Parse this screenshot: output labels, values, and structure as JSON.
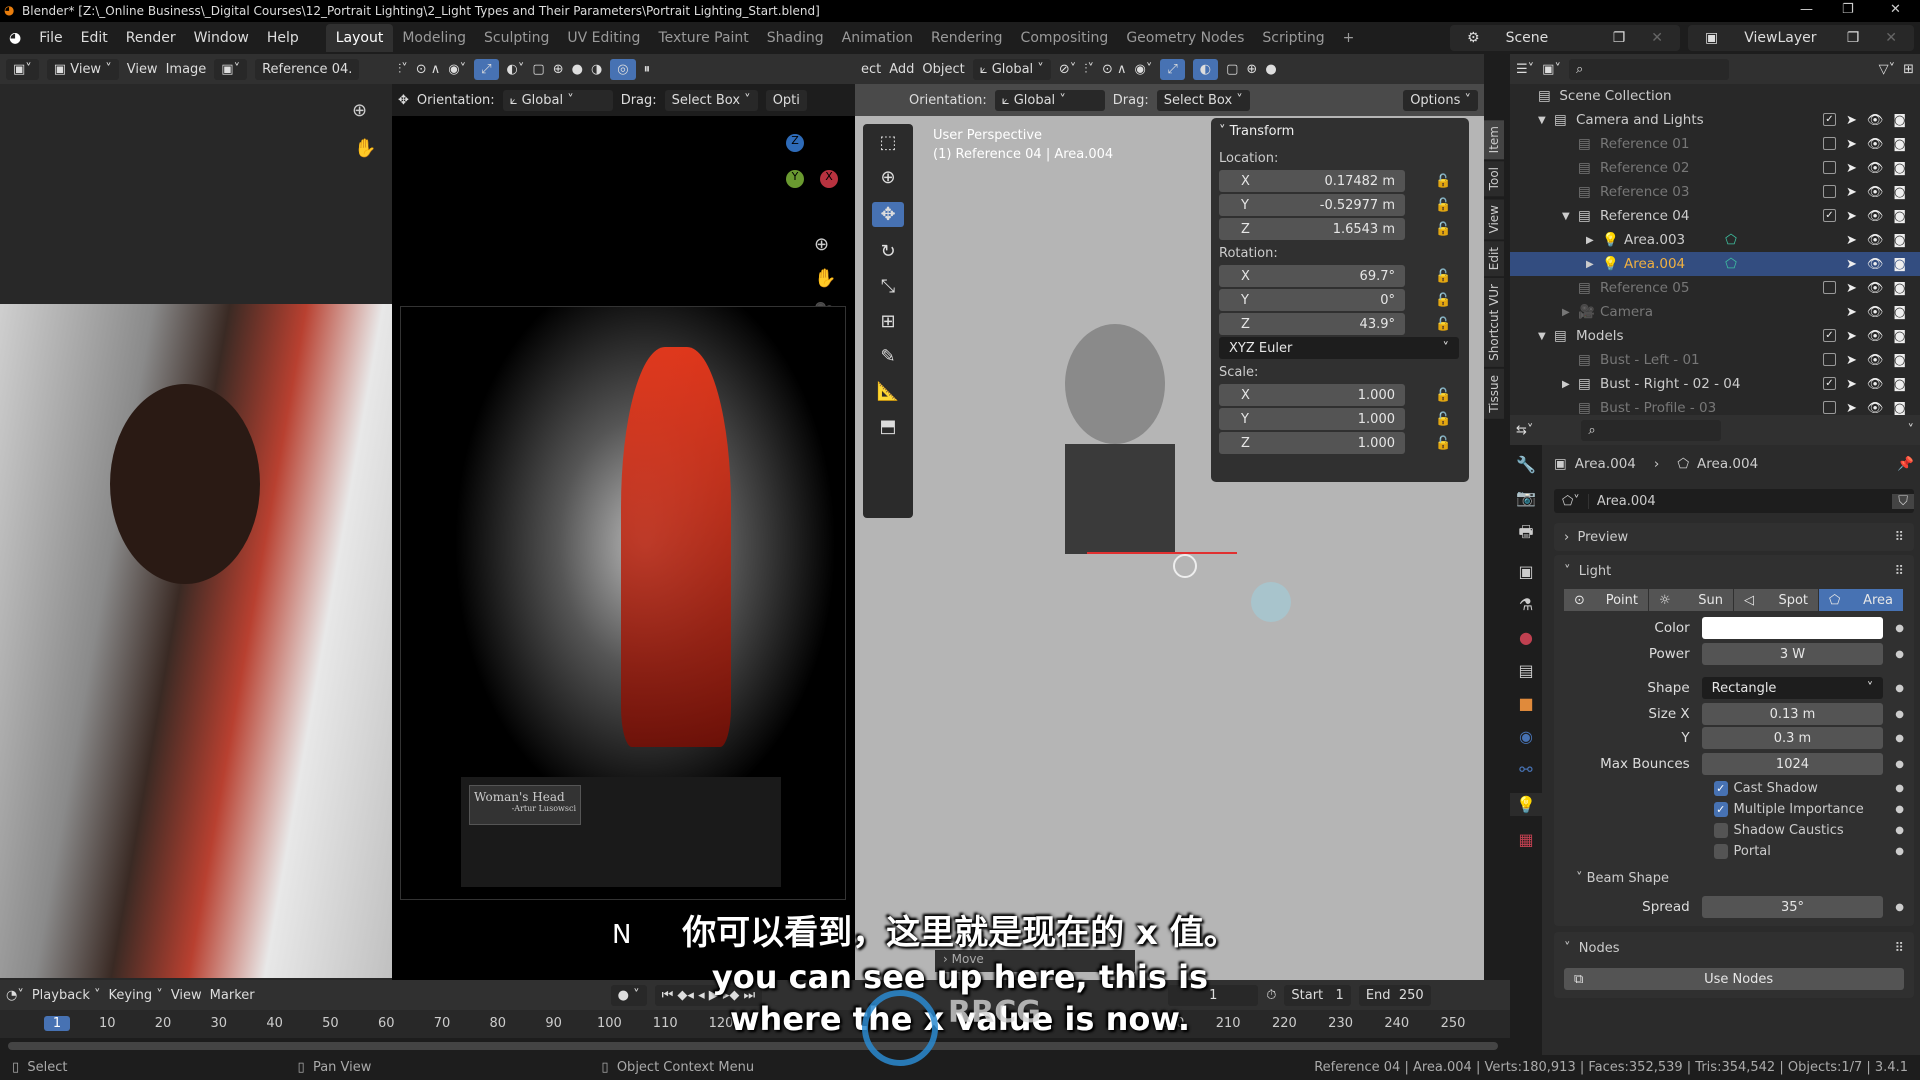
{
  "titlebar": {
    "title": "Blender* [Z:\\_Online Business\\_Digital Courses\\12_Portrait Lighting\\2_Light Types and Their Parameters\\Portrait Lighting_Start.blend]"
  },
  "menu": [
    "File",
    "Edit",
    "Render",
    "Window",
    "Help"
  ],
  "workspaces": [
    "Layout",
    "Modeling",
    "Sculpting",
    "UV Editing",
    "Texture Paint",
    "Shading",
    "Animation",
    "Rendering",
    "Compositing",
    "Geometry Nodes",
    "Scripting",
    "+"
  ],
  "scene": {
    "name": "Scene",
    "view_layer": "ViewLayer"
  },
  "image_editor": {
    "view_menu": "View",
    "menus": [
      "View",
      "Image"
    ],
    "image_name": "Reference 04."
  },
  "camera_view": {
    "orientation_label": "Orientation:",
    "orientation": "Global",
    "drag_label": "Drag:",
    "drag": "Select Box",
    "options": "Opti",
    "plaque_title": "Woman's Head",
    "plaque_sub": "-Artur Lusowsci",
    "letter": "N"
  },
  "viewport": {
    "menus": [
      "ect",
      "Add",
      "Object"
    ],
    "transform_orientation": "Global",
    "orientation_label": "Orientation:",
    "orientation": "Global",
    "drag_label": "Drag:",
    "drag": "Select Box",
    "options": "Options",
    "overlay_title": "User Perspective",
    "overlay_sub": "(1) Reference 04 | Area.004",
    "operator": "Move"
  },
  "sidebar_tabs": [
    "Item",
    "Tool",
    "View",
    "Edit",
    "Shortcut VUr",
    "Tissue"
  ],
  "transform": {
    "title": "Transform",
    "location_label": "Location:",
    "location": [
      {
        "axis": "X",
        "value": "0.17482 m"
      },
      {
        "axis": "Y",
        "value": "-0.52977 m"
      },
      {
        "axis": "Z",
        "value": "1.6543 m"
      }
    ],
    "rotation_label": "Rotation:",
    "rotation": [
      {
        "axis": "X",
        "value": "69.7°"
      },
      {
        "axis": "Y",
        "value": "0°"
      },
      {
        "axis": "Z",
        "value": "43.9°"
      }
    ],
    "rotation_mode": "XYZ Euler",
    "scale_label": "Scale:",
    "scale": [
      {
        "axis": "X",
        "value": "1.000"
      },
      {
        "axis": "Y",
        "value": "1.000"
      },
      {
        "axis": "Z",
        "value": "1.000"
      }
    ]
  },
  "outliner": {
    "root": "Scene Collection",
    "items": [
      {
        "label": "Camera and Lights",
        "depth": 0,
        "expanded": true,
        "checked": true,
        "dim": false
      },
      {
        "label": "Reference 01",
        "depth": 1,
        "checked": false,
        "dim": true
      },
      {
        "label": "Reference 02",
        "depth": 1,
        "checked": false,
        "dim": true
      },
      {
        "label": "Reference 03",
        "depth": 1,
        "checked": false,
        "dim": true
      },
      {
        "label": "Reference 04",
        "depth": 1,
        "expanded": true,
        "checked": true,
        "dim": false
      },
      {
        "label": "Area.003",
        "depth": 2,
        "light": true,
        "dim": false
      },
      {
        "label": "Area.004",
        "depth": 2,
        "light": true,
        "selected": true
      },
      {
        "label": "Reference 05",
        "depth": 1,
        "checked": false,
        "dim": true
      },
      {
        "label": "Camera",
        "depth": 1,
        "camera": true,
        "dim": true
      },
      {
        "label": "Models",
        "depth": 0,
        "expanded": true,
        "checked": true,
        "dim": false
      },
      {
        "label": "Bust - Left - 01",
        "depth": 1,
        "checked": false,
        "dim": true
      },
      {
        "label": "Bust - Right - 02 - 04",
        "depth": 1,
        "checked": true,
        "dim": false
      },
      {
        "label": "Bust - Profile - 03",
        "depth": 1,
        "checked": false,
        "dim": true
      }
    ]
  },
  "properties": {
    "breadcrumb_object": "Area.004",
    "breadcrumb_data": "Area.004",
    "datablock": "Area.004",
    "preview": "Preview",
    "light_panel": "Light",
    "light_types": [
      "Point",
      "Sun",
      "Spot",
      "Area"
    ],
    "active_type": "Area",
    "color_label": "Color",
    "color": "#ffffff",
    "power_label": "Power",
    "power": "3 W",
    "shape_label": "Shape",
    "shape": "Rectangle",
    "size_x_label": "Size X",
    "size_x": "0.13 m",
    "size_y_label": "Y",
    "size_y": "0.3 m",
    "max_bounces_label": "Max Bounces",
    "max_bounces": "1024",
    "checks": [
      {
        "label": "Cast Shadow",
        "on": true
      },
      {
        "label": "Multiple Importance",
        "on": true
      },
      {
        "label": "Shadow Caustics",
        "on": false
      },
      {
        "label": "Portal",
        "on": false
      }
    ],
    "beam_shape": "Beam Shape",
    "spread_label": "Spread",
    "spread": "35°",
    "nodes": "Nodes",
    "use_nodes": "Use Nodes"
  },
  "timeline": {
    "menus": [
      "Playback",
      "Keying",
      "View",
      "Marker"
    ],
    "current_frame": "1",
    "start_label": "Start",
    "start": "1",
    "end_label": "End",
    "end": "250",
    "ticks": [
      "1",
      "10",
      "20",
      "30",
      "40",
      "50",
      "60",
      "70",
      "80",
      "90",
      "100",
      "110",
      "120",
      "200",
      "210",
      "220",
      "230",
      "240",
      "250"
    ]
  },
  "statusbar": {
    "select": "Select",
    "pan": "Pan View",
    "context": "Object Context Menu",
    "stats": "Reference 04 | Area.004 | Verts:180,913 | Faces:352,539 | Tris:354,542 | Objects:1/7 | 3.4.1"
  },
  "subtitles": {
    "zh": "你可以看到，这里就是现在的 x 值。",
    "en1": "you can see up here, this is",
    "en2": "where the x value is now."
  },
  "watermark": "RRCG",
  "colors": {
    "accent": "#4772b3",
    "selected_row": "#334d80",
    "light_icon": "#e08a3b"
  }
}
